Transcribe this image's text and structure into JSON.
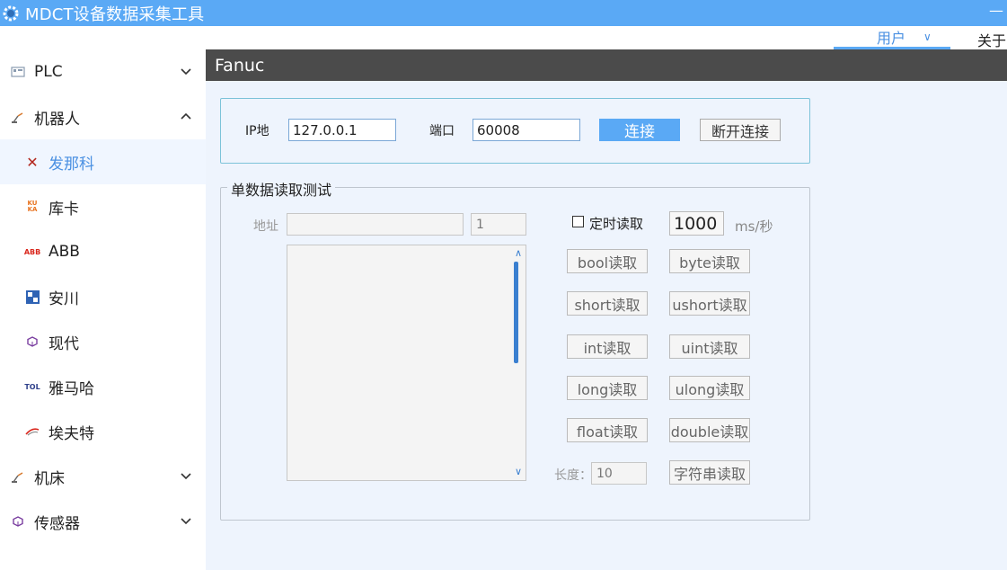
{
  "window": {
    "title": "MDCT设备数据采集工具",
    "minimize": "—"
  },
  "menu": {
    "user": "用户",
    "about": "关于"
  },
  "sidebar": {
    "plc": "PLC",
    "robot": "机器人",
    "robots": [
      "发那科",
      "库卡",
      "ABB",
      "安川",
      "现代",
      "雅马哈",
      "埃夫特"
    ],
    "machine": "机床",
    "sensor": "传感器"
  },
  "icons": {
    "kuka": "KU KA",
    "tol": "TOL"
  },
  "main": {
    "title": "Fanuc"
  },
  "connection": {
    "ip_label": "IP地",
    "ip_value": "127.0.0.1",
    "port_label": "端口",
    "port_value": "60008",
    "connect": "连接",
    "disconnect": "断开连接"
  },
  "test": {
    "title": "单数据读取测试",
    "address_label": "地址",
    "address_value": "",
    "count_value": "1",
    "timer_label": "定时读取",
    "interval_value": "1000",
    "interval_unit": "ms/秒",
    "length_label": "长度：",
    "length_value": "10",
    "buttons": [
      "bool读取",
      "byte读取",
      "short读取",
      "ushort读取",
      "int读取",
      "uint读取",
      "long读取",
      "ulong读取",
      "float读取",
      "double读取"
    ],
    "string_button": "字符串读取"
  },
  "colors": {
    "accent": "#5aa9f5",
    "header": "#4b4b4b",
    "active_text": "#4a90e2"
  }
}
